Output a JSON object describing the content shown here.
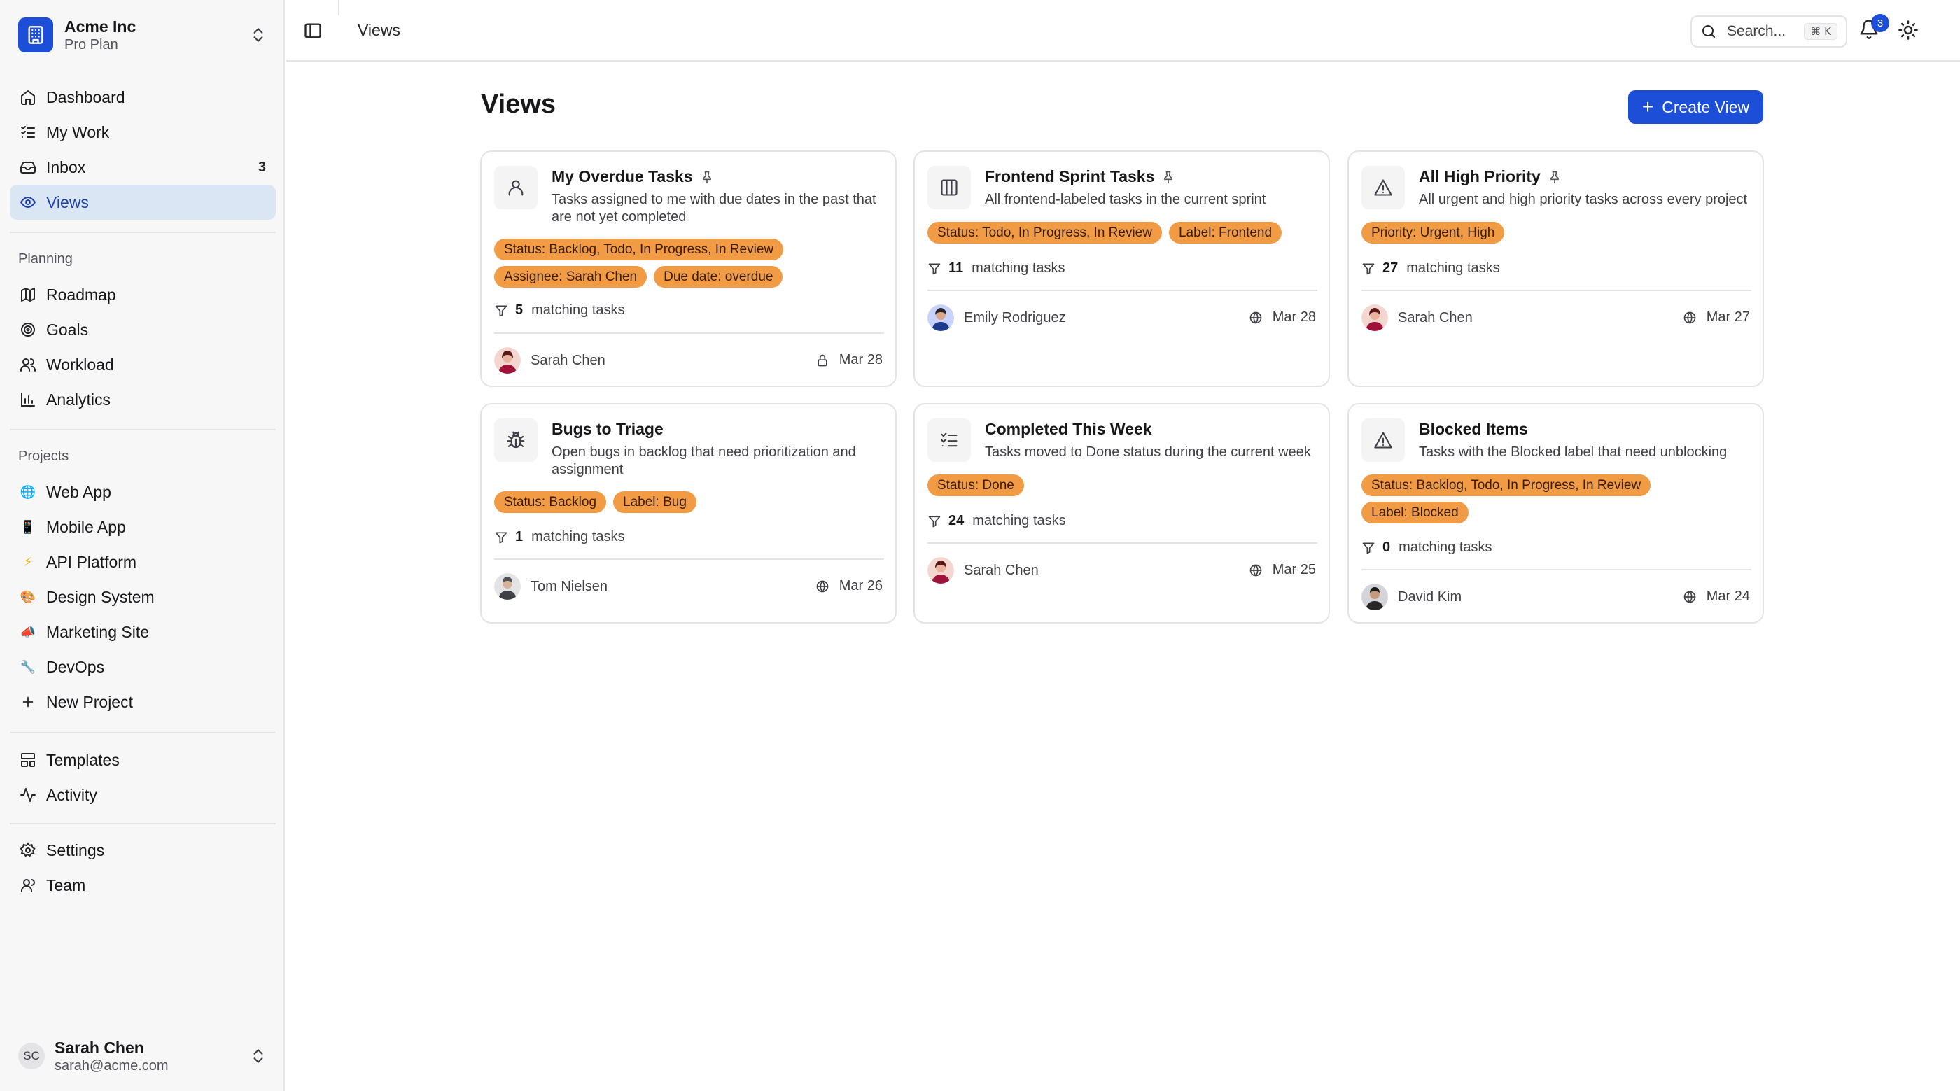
{
  "team": {
    "name": "Acme Inc",
    "plan": "Pro Plan"
  },
  "nav": {
    "main": [
      {
        "label": "Dashboard",
        "icon": "home-icon"
      },
      {
        "label": "My Work",
        "icon": "list-check-icon"
      },
      {
        "label": "Inbox",
        "icon": "inbox-icon",
        "count": "3"
      },
      {
        "label": "Views",
        "icon": "eye-icon",
        "active": true
      }
    ],
    "planning_label": "Planning",
    "planning": [
      {
        "label": "Roadmap",
        "icon": "map-icon"
      },
      {
        "label": "Goals",
        "icon": "target-icon"
      },
      {
        "label": "Workload",
        "icon": "users-icon"
      },
      {
        "label": "Analytics",
        "icon": "bar-chart-icon"
      }
    ],
    "projects_label": "Projects",
    "projects": [
      {
        "label": "Web App",
        "emoji": "🌐"
      },
      {
        "label": "Mobile App",
        "emoji": "📱"
      },
      {
        "label": "API Platform",
        "emoji": "⚡"
      },
      {
        "label": "Design System",
        "emoji": "🎨"
      },
      {
        "label": "Marketing Site",
        "emoji": "📣"
      },
      {
        "label": "DevOps",
        "emoji": "🔧"
      },
      {
        "label": "New Project",
        "icon": "plus-icon"
      }
    ],
    "other": [
      {
        "label": "Templates",
        "icon": "template-icon"
      },
      {
        "label": "Activity",
        "icon": "activity-icon"
      }
    ],
    "settings": [
      {
        "label": "Settings",
        "icon": "gear-icon"
      },
      {
        "label": "Team",
        "icon": "team-icon"
      }
    ]
  },
  "user": {
    "initials": "SC",
    "name": "Sarah Chen",
    "email": "sarah@acme.com"
  },
  "topbar": {
    "breadcrumb": "Views",
    "search_placeholder": "Search...",
    "search_shortcut": "⌘ K",
    "notification_count": "3"
  },
  "page": {
    "title": "Views",
    "create_label": "Create View"
  },
  "colors": {
    "accent": "#1d4ed8",
    "chip": "#f29b45",
    "active_nav_bg": "#dbe6f5"
  },
  "views": [
    {
      "title": "My Overdue Tasks",
      "icon": "user-icon",
      "pinned": true,
      "description": "Tasks assigned to me with due dates in the past that are not yet completed",
      "chips": [
        "Status: Backlog, Todo, In Progress, In Review",
        "Assignee: Sarah Chen",
        "Due date: overdue"
      ],
      "count": "5",
      "count_label": "matching tasks",
      "owner": "Sarah Chen",
      "owner_avatar": "red",
      "visibility_icon": "lock-icon",
      "date": "Mar 28"
    },
    {
      "title": "Frontend Sprint Tasks",
      "icon": "columns-icon",
      "pinned": true,
      "description": "All frontend-labeled tasks in the current sprint",
      "chips": [
        "Status: Todo, In Progress, In Review",
        "Label: Frontend"
      ],
      "count": "11",
      "count_label": "matching tasks",
      "owner": "Emily Rodriguez",
      "owner_avatar": "blue",
      "visibility_icon": "globe-icon",
      "date": "Mar 28"
    },
    {
      "title": "All High Priority",
      "icon": "alert-triangle-icon",
      "pinned": true,
      "description": "All urgent and high priority tasks across every project",
      "chips": [
        "Priority: Urgent, High"
      ],
      "count": "27",
      "count_label": "matching tasks",
      "owner": "Sarah Chen",
      "owner_avatar": "red",
      "visibility_icon": "globe-icon",
      "date": "Mar 27"
    },
    {
      "title": "Bugs to Triage",
      "icon": "bug-icon",
      "pinned": false,
      "description": "Open bugs in backlog that need prioritization and assignment",
      "chips": [
        "Status: Backlog",
        "Label: Bug"
      ],
      "count": "1",
      "count_label": "matching tasks",
      "owner": "Tom Nielsen",
      "owner_avatar": "gray",
      "visibility_icon": "globe-icon",
      "date": "Mar 26"
    },
    {
      "title": "Completed This Week",
      "icon": "list-check-icon",
      "pinned": false,
      "description": "Tasks moved to Done status during the current week",
      "chips": [
        "Status: Done"
      ],
      "count": "24",
      "count_label": "matching tasks",
      "owner": "Sarah Chen",
      "owner_avatar": "red",
      "visibility_icon": "globe-icon",
      "date": "Mar 25"
    },
    {
      "title": "Blocked Items",
      "icon": "alert-triangle-icon",
      "pinned": false,
      "description": "Tasks with the Blocked label that need unblocking",
      "chips": [
        "Status: Backlog, Todo, In Progress, In Review",
        "Label: Blocked"
      ],
      "count": "0",
      "count_label": "matching tasks",
      "owner": "David Kim",
      "owner_avatar": "dark",
      "visibility_icon": "globe-icon",
      "date": "Mar 24"
    }
  ]
}
